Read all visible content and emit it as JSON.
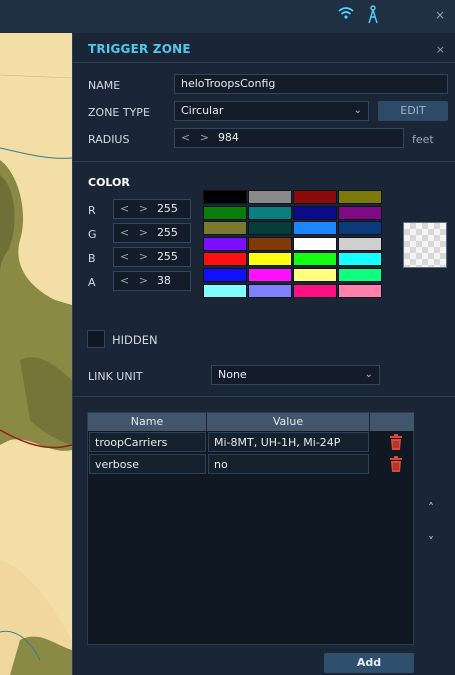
{
  "topbar": {
    "wifi_icon": "wifi-icon",
    "antenna_icon": "antenna-icon",
    "close_label": "×"
  },
  "panel": {
    "title": "TRIGGER ZONE",
    "close_label": "×",
    "name": {
      "label": "NAME",
      "value": "heloTroopsConfig"
    },
    "zone_type": {
      "label": "ZONE TYPE",
      "value": "Circular",
      "edit_label": "EDIT"
    },
    "radius": {
      "label": "RADIUS",
      "arrows": "< >",
      "value": "984",
      "unit": "feet"
    },
    "color": {
      "title": "COLOR",
      "r": {
        "label": "R",
        "arrows": "< >",
        "value": "255"
      },
      "g": {
        "label": "G",
        "arrows": "< >",
        "value": "255"
      },
      "b": {
        "label": "B",
        "arrows": "< >",
        "value": "255"
      },
      "a": {
        "label": "A",
        "arrows": "< >",
        "value": "38"
      },
      "swatches": [
        "#000000",
        "#8a8a8a",
        "#8b0a0a",
        "#7d7a0c",
        "#0a7d0a",
        "#0b7f7f",
        "#0a0a8b",
        "#7f0a85",
        "#7c7a2e",
        "#063c3a",
        "#1a86ff",
        "#0a3a7a",
        "#7a10ff",
        "#7f3a08",
        "#ffffff",
        "#cfcfcf",
        "#ff1010",
        "#ffff10",
        "#15ff15",
        "#15ffff",
        "#1010ff",
        "#ff10ff",
        "#ffff80",
        "#10ff80",
        "#80ffff",
        "#8080ff",
        "#ff1080",
        "#ff80a8"
      ]
    },
    "hidden": {
      "label": "HIDDEN",
      "checked": false
    },
    "link_unit": {
      "label": "LINK UNIT",
      "value": "None"
    },
    "table": {
      "columns": [
        "Name",
        "Value"
      ],
      "rows": [
        {
          "name": "troopCarriers",
          "value": "Mi-8MT, UH-1H, Mi-24P"
        },
        {
          "name": "verbose",
          "value": "no"
        }
      ]
    },
    "scroll_up": "˄",
    "scroll_down": "˅",
    "add_label": "Add"
  },
  "colors": {
    "accent": "#52c8f0",
    "panel_bg": "#1a2636",
    "trash": "#e0453a"
  }
}
